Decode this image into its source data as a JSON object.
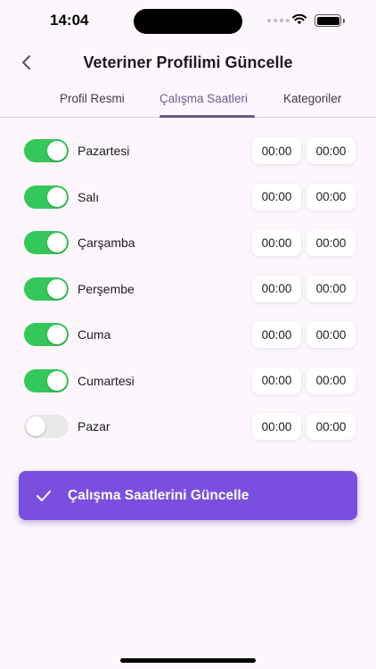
{
  "status_bar": {
    "time": "14:04"
  },
  "header": {
    "title": "Veteriner Profilimi Güncelle",
    "back_icon": "chevron-left-icon"
  },
  "tabs": [
    {
      "label": "Profil Resmi",
      "active": false
    },
    {
      "label": "Çalışma Saatleri",
      "active": true
    },
    {
      "label": "Kategoriler",
      "active": false
    }
  ],
  "schedule": [
    {
      "day": "Pazartesi",
      "enabled": true,
      "start": "00:00",
      "end": "00:00"
    },
    {
      "day": "Salı",
      "enabled": true,
      "start": "00:00",
      "end": "00:00"
    },
    {
      "day": "Çarşamba",
      "enabled": true,
      "start": "00:00",
      "end": "00:00"
    },
    {
      "day": "Perşembe",
      "enabled": true,
      "start": "00:00",
      "end": "00:00"
    },
    {
      "day": "Cuma",
      "enabled": true,
      "start": "00:00",
      "end": "00:00"
    },
    {
      "day": "Cumartesi",
      "enabled": true,
      "start": "00:00",
      "end": "00:00"
    },
    {
      "day": "Pazar",
      "enabled": false,
      "start": "00:00",
      "end": "00:00"
    }
  ],
  "update_button": {
    "label": "Çalışma Saatlerini Güncelle",
    "icon": "check-icon"
  },
  "colors": {
    "accent": "#7a4fe0",
    "toggle_on": "#34c759",
    "toggle_off": "#e9e9eb",
    "tab_active": "#6a5a86",
    "background": "#fdf7fd"
  }
}
